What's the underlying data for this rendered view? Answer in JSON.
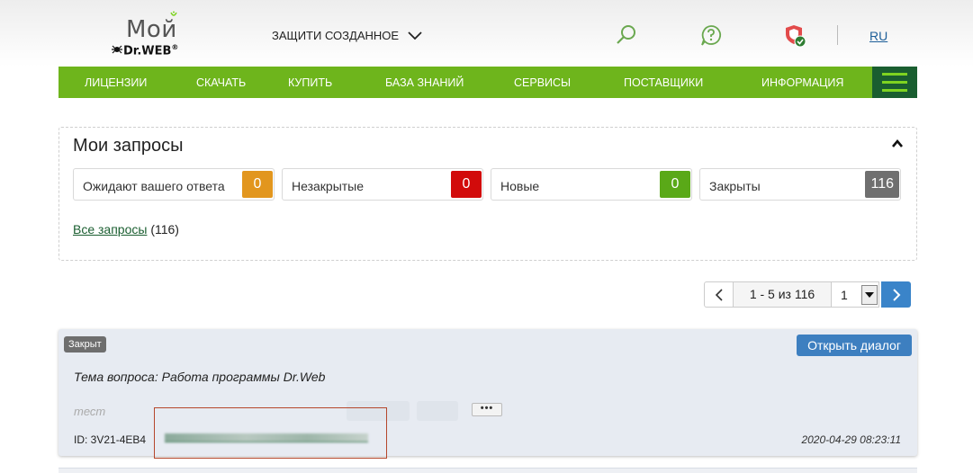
{
  "header": {
    "logo_text": "Мой",
    "brand_text": "Dr.WEB",
    "brand_mark": "®",
    "slogan": "ЗАЩИТИ СОЗДАННОЕ",
    "lang": "RU",
    "icons": [
      "search-icon",
      "help-icon",
      "shield-status-icon"
    ]
  },
  "nav": {
    "items": [
      "ЛИЦЕНЗИИ",
      "СКАЧАТЬ",
      "КУПИТЬ",
      "БАЗА ЗНАНИЙ",
      "СЕРВИСЫ",
      "ПОСТАВЩИКИ",
      "ИНФОРМАЦИЯ"
    ]
  },
  "requests": {
    "title": "Мои запросы",
    "stats": [
      {
        "label": "Ожидают вашего ответа",
        "count": "0",
        "color": "#e2961e"
      },
      {
        "label": "Незакрытые",
        "count": "0",
        "color": "#d20b0b"
      },
      {
        "label": "Новые",
        "count": "0",
        "color": "#5aa918"
      },
      {
        "label": "Закрыты",
        "count": "116",
        "color": "#6f6f6f"
      }
    ],
    "all_link": "Все запросы",
    "all_count": "(116)"
  },
  "pager": {
    "range": "1 - 5 из 116",
    "page": "1"
  },
  "ticket": {
    "status": "Закрыт",
    "open_button": "Открыть диалог",
    "subject": "Тема вопроса: Работа программы Dr.Web",
    "author": "тест",
    "more": "•••",
    "id": "ID: 3V21-4EB4",
    "date": "2020-04-29 08:23:11"
  },
  "colors": {
    "nav_green": "#6eb51c",
    "burger_dark": "#1a5e30",
    "accent_blue": "#3d7fc0"
  }
}
